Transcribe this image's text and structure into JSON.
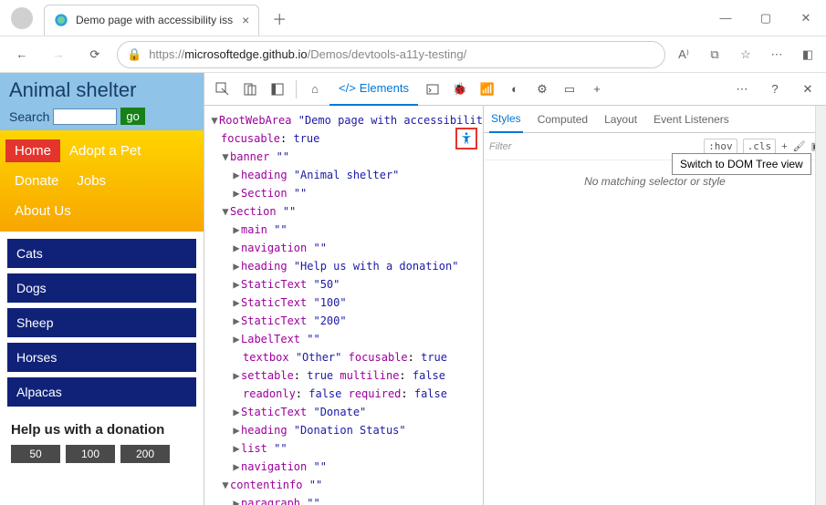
{
  "browser": {
    "tab_title": "Demo page with accessibility iss",
    "url_prefix": "https://",
    "url_host": "microsoftedge.github.io",
    "url_path": "/Demos/devtools-a11y-testing/"
  },
  "page": {
    "title": "Animal shelter",
    "search_label": "Search",
    "go_label": "go",
    "nav": {
      "home": "Home",
      "adopt": "Adopt a Pet",
      "donate": "Donate",
      "jobs": "Jobs",
      "about": "About Us"
    },
    "animals": [
      "Cats",
      "Dogs",
      "Sheep",
      "Horses",
      "Alpacas"
    ],
    "donate_heading": "Help us with a donation",
    "amounts": [
      "50",
      "100",
      "200"
    ]
  },
  "devtools": {
    "elements_tab": "Elements",
    "tooltip": "Switch to DOM Tree view",
    "styles": {
      "tabs": {
        "styles": "Styles",
        "computed": "Computed",
        "layout": "Layout",
        "listeners": "Event Listeners"
      },
      "filter_placeholder": "Filter",
      "hov": ":hov",
      "cls": ".cls",
      "no_match": "No matching selector or style"
    },
    "tree": {
      "root_role": "RootWebArea",
      "root_name": "\"Demo page with accessibility issues\"",
      "focusable": "focusable",
      "true": "true",
      "false": "false",
      "banner": "banner",
      "heading": "heading",
      "animal_shelter": "\"Animal shelter\"",
      "section": "Section",
      "main": "main",
      "navigation": "navigation",
      "help_donation": "\"Help us with a donation\"",
      "statictext": "StaticText",
      "st50": "\"50\"",
      "st100": "\"100\"",
      "st200": "\"200\"",
      "labeltext": "LabelText",
      "textbox": "textbox",
      "other": "\"Other\"",
      "settable": "settable",
      "multiline": "multiline",
      "readonly": "readonly",
      "required": "required",
      "donate": "\"Donate\"",
      "donation_status": "\"Donation Status\"",
      "list": "list",
      "contentinfo": "contentinfo",
      "paragraph": "paragraph",
      "empty": "\"\""
    }
  }
}
